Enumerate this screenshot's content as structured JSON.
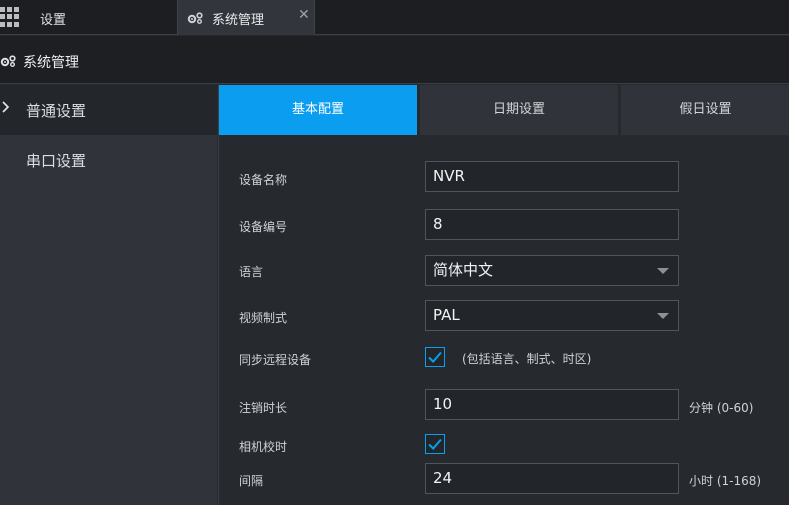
{
  "topbar": {
    "settings_label": "设置",
    "active_tab_label": "系统管理",
    "close_glyph": "✕"
  },
  "header": {
    "title": "系统管理"
  },
  "sidebar": {
    "items": [
      {
        "label": "普通设置",
        "active": true
      },
      {
        "label": "串口设置",
        "active": false
      }
    ]
  },
  "tabs": [
    {
      "label": "基本配置",
      "active": true
    },
    {
      "label": "日期设置",
      "active": false
    },
    {
      "label": "假日设置",
      "active": false
    }
  ],
  "form": {
    "device_name": {
      "label": "设备名称",
      "value": "NVR"
    },
    "device_no": {
      "label": "设备编号",
      "value": "8"
    },
    "language": {
      "label": "语言",
      "value": "简体中文"
    },
    "video_standard": {
      "label": "视频制式",
      "value": "PAL"
    },
    "sync_remote": {
      "label": "同步远程设备",
      "checked": true,
      "hint": "(包括语言、制式、时区)"
    },
    "logout_time": {
      "label": "注销时长",
      "value": "10",
      "unit": "分钟 (0-60)"
    },
    "camera_time_sync": {
      "label": "相机校时",
      "checked": true
    },
    "interval": {
      "label": "间隔",
      "value": "24",
      "unit": "小时 (1-168)"
    }
  },
  "colors": {
    "accent": "#0b9ef0",
    "background": "#26292e",
    "sidebar": "#303339"
  },
  "icons": {
    "apps": "grid-icon",
    "settings": "gear-icon",
    "check": "check-icon"
  }
}
